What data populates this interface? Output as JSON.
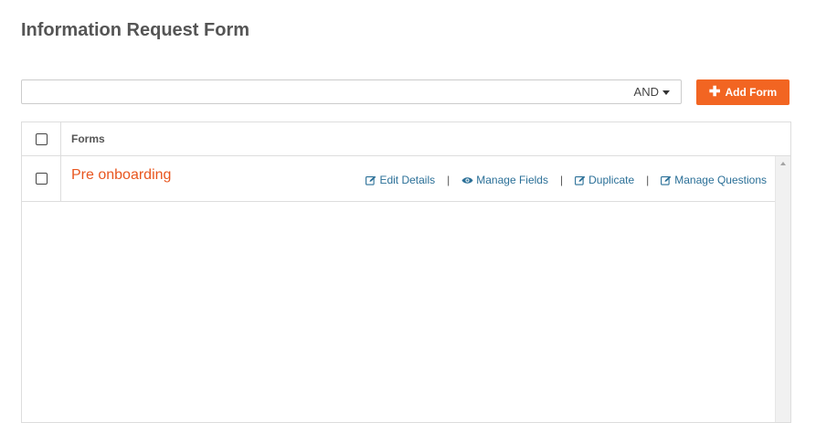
{
  "page": {
    "title": "Information Request Form"
  },
  "search": {
    "value": "",
    "placeholder": "",
    "operator": "AND"
  },
  "toolbar": {
    "add_label": "Add Form",
    "add_icon": "plus-icon",
    "accent_color": "#f26522"
  },
  "table": {
    "header": "Forms",
    "rows": [
      {
        "name": "Pre onboarding",
        "actions": [
          {
            "label": "Edit Details",
            "icon": "edit-icon"
          },
          {
            "label": "Manage Fields",
            "icon": "eye-icon"
          },
          {
            "label": "Duplicate",
            "icon": "edit-icon"
          },
          {
            "label": "Manage Questions",
            "icon": "edit-icon"
          }
        ]
      }
    ],
    "separator": "|"
  }
}
